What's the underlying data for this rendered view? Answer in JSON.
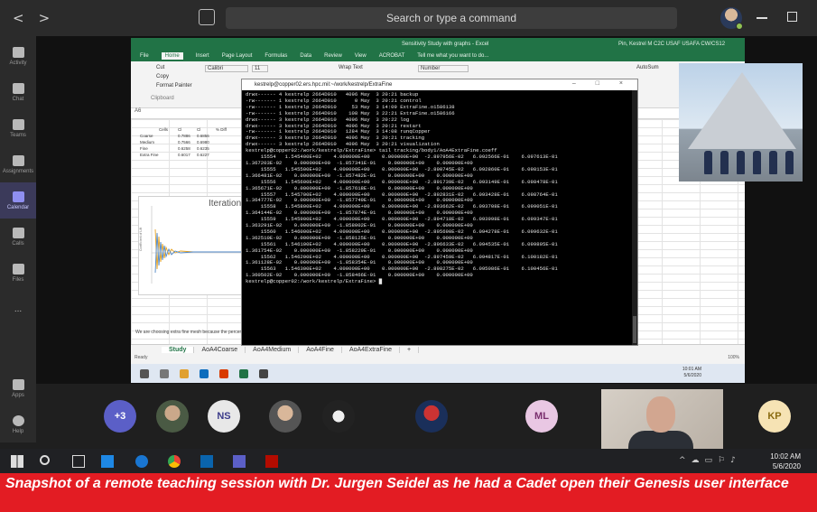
{
  "teams": {
    "search_placeholder": "Search or type a command",
    "nav_back": "<",
    "nav_forward": ">",
    "rail": [
      {
        "label": "Activity"
      },
      {
        "label": "Chat"
      },
      {
        "label": "Teams"
      },
      {
        "label": "Assignments"
      },
      {
        "label": "Calendar",
        "active": true
      },
      {
        "label": "Calls"
      },
      {
        "label": "Files"
      },
      {
        "label": "..."
      },
      {
        "label": "Apps"
      },
      {
        "label": "Help"
      }
    ]
  },
  "excel": {
    "doc_title": "Sensitivity Study with graphs - Excel",
    "user": "Pin, Kestrel M C2C USAF USAFA CW/CS12",
    "share": "Share",
    "tabs": [
      "File",
      "Home",
      "Insert",
      "Page Layout",
      "Formulas",
      "Data",
      "Review",
      "View",
      "ACROBAT",
      "Tell me what you want to do..."
    ],
    "selected_tab": "Home",
    "ribbon": {
      "cut": "Cut",
      "copy": "Copy",
      "format_painter": "Format Painter",
      "clipboard": "Clipboard",
      "font": "Calibri",
      "font_size": "11",
      "wrap_text": "Wrap Text",
      "number_format": "Number",
      "autosum": "AutoSum"
    },
    "name_box": "A6",
    "cells": [
      [
        "",
        "Cells",
        "Cl",
        "Cl",
        "% Diff"
      ],
      [
        "Coarse",
        "",
        "0.7886",
        "0.6856",
        ""
      ],
      [
        "Medium",
        "",
        "0.7566",
        "0.6980",
        ""
      ],
      [
        "Fine",
        "",
        "0.6258",
        "0.6235",
        ""
      ],
      [
        "Extra Fine",
        "",
        "0.6017",
        "0.6227",
        ""
      ]
    ],
    "chart_title": "Iterations",
    "chart_ylabel": "Coefficient of Lift",
    "footer_note": "We are choosing extra fine mesh because the percent difference between the fine and extra fine meshes is less than 1 ...",
    "sheet_tabs": [
      "Study",
      "AoA4Coarse",
      "AoA4Medium",
      "AoA4Fine",
      "AoA4ExtraFine",
      "+"
    ],
    "selected_sheet": "Study",
    "status": "Ready",
    "zoom": "100%",
    "inner_time": "10:01 AM",
    "inner_date": "5/6/2020"
  },
  "terminal": {
    "title": "kestrelp@copper02.ers.hpc.mil:~/work/kestrelp/ExtraFine",
    "lines": [
      "drwx------ 4 kestrelp 2664D010   4096 May  3 20:21 backup",
      "-rw------- 1 kestrelp 2664D010      0 May  3 20:21 control",
      "-rw------- 1 kestrelp 2664D010     53 May  3 14:09 ExtraFine.o1586138",
      "-rw------- 1 kestrelp 2664D010    108 May  3 22:21 ExtraFine.o1586166",
      "drwx------ 3 kestrelp 2664D010   4096 May  3 20:22 log",
      "drwx------ 3 kestrelp 2664D010   4096 May  3 20:21 restart",
      "-rw------- 1 kestrelp 2664D010   1284 May  3 14:08 runqCopper",
      "drwx------ 3 kestrelp 2664D010   4096 May  3 20:21 tracking",
      "drwx------ 3 kestrelp 2664D010   4096 May  3 20:21 visualization",
      "kestrelp@copper02:/work/kestrelp/ExtraFine> tail tracking/body1/AoA4ExtraFine.coeff",
      "     15554   1.545400E+02    4.000000E+00    0.000000E+00  -2.897956E-02   6.092566E-01    6.097613E-01",
      "1.367203E-02    0.000000E+00  -1.857341E-01    0.000000E+00    0.000000E+00",
      "     15555   1.545500E+02    4.000000E+00    0.000000E+00  -2.890745E-02   6.092860E-01    6.098153E-01",
      "1.366481E-02    0.000000E+00  -1.857482E-01    0.000000E+00    0.000000E+00",
      "     15556   1.545600E+02    4.000000E+00    0.000000E+00  -2.891739E-02   6.093149E-01    6.098478E-01",
      "1.365671E-02    0.000000E+00  -1.857618E-01    0.000000E+00    0.000000E+00",
      "     15557   1.545700E+02    4.000000E+00    0.000000E+00  -2.892831E-02   6.093428E-01    6.098764E-01",
      "1.364777E-02    0.000000E+00  -1.857749E-01    0.000000E+00    0.000000E+00",
      "     15558   1.545800E+02    4.000000E+00    0.000000E+00  -2.893662E-02   6.093708E-01    6.099051E-01",
      "1.364144E-02    0.000000E+00  -1.857874E-01    0.000000E+00    0.000000E+00",
      "     15559   1.545900E+02    4.000000E+00    0.000000E+00  -2.894718E-02   6.093998E-01    6.099347E-01",
      "1.363291E-02    0.000000E+00  -1.858002E-01    0.000000E+00    0.000000E+00",
      "     15560   1.546000E+02    4.000000E+00    0.000000E+00  -2.895690E-02   6.094278E-01    6.099632E-01",
      "1.362510E-02    0.000000E+00  -1.858125E-01    0.000000E+00    0.000000E+00",
      "     15561   1.546100E+02    4.000000E+00    0.000000E+00  -2.896633E-02   6.094535E-01    6.099895E-01",
      "1.361754E-02    0.000000E+00  -1.858229E-01    0.000000E+00    0.000000E+00",
      "     15562   1.546200E+02    4.000000E+00    0.000000E+00  -2.897459E-02   6.094817E-01    6.100182E-01",
      "1.361128E-02    0.000000E+00  -1.858354E-01    0.000000E+00    0.000000E+00",
      "     15563   1.546300E+02    4.000000E+00    0.000000E+00  -2.898275E-02   6.095086E-01    6.100456E-01",
      "1.360502E-02    0.000000E+00  -1.858466E-01    0.000000E+00    0.000000E+00",
      "kestrelp@copper02:/work/kestrelp/ExtraFine> █"
    ]
  },
  "participants": [
    {
      "initials": "+3",
      "color": "#5b5fc7",
      "text_color": "#ffffff"
    },
    {
      "initials": "",
      "kind": "photo"
    },
    {
      "initials": "NS",
      "color": "#e8e8e8",
      "text_color": "#3b3b8a"
    },
    {
      "initials": "",
      "kind": "photo"
    },
    {
      "initials": "",
      "kind": "photo"
    },
    {
      "initials": "",
      "kind": "photo"
    },
    {
      "initials": "ML",
      "color": "#e9c7e3",
      "text_color": "#7a2f6e"
    },
    {
      "initials": "KP",
      "color": "#f6e3b4",
      "text_color": "#8a6b10"
    }
  ],
  "windows": {
    "time": "10:02 AM",
    "date": "5/6/2020"
  },
  "caption": "Snapshot of a remote teaching session with Dr. Jurgen Seidel as he had a Cadet open their Genesis user interface"
}
